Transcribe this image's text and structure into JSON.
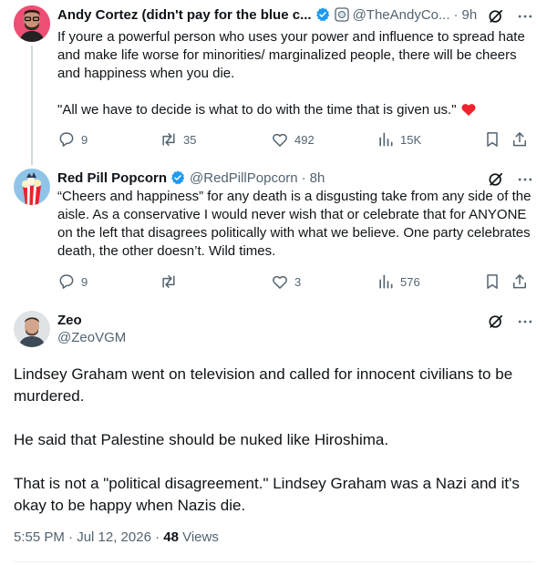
{
  "tweets": [
    {
      "name": "Andy Cortez (didn't pay for the blue c...",
      "handle": "@TheAndyCo...",
      "time": "9h",
      "text": [
        "If youre a powerful person who uses your power and influence to spread hate and make life worse for minorities/ marginalized people, there will be cheers and happiness when you die.",
        "\"All we have to decide is what to do with the time that is given us.\""
      ],
      "replies": "9",
      "reposts": "35",
      "likes": "492",
      "views": "15K"
    },
    {
      "name": "Red Pill Popcorn",
      "handle": "@RedPillPopcorn",
      "time": "8h",
      "text": [
        "“Cheers and happiness” for any death is a disgusting take from any side of the aisle. As a conservative I would never wish that or celebrate that for ANYONE on the left that disagrees politically with what we believe. One party celebrates death, the other doesn’t. Wild times."
      ],
      "replies": "9",
      "reposts": "",
      "likes": "3",
      "views": "576"
    }
  ],
  "focal": {
    "name": "Zeo",
    "handle": "@ZeoVGM",
    "paragraphs": [
      "Lindsey Graham went on television and called for innocent civilians to be murdered.",
      "He said that Palestine should be nuked like Hiroshima.",
      "That is not a \"political disagreement.\" Lindsey Graham was a Nazi and it's okay to be happy when Nazis die."
    ],
    "time": "5:55 PM · Jul 12, 2026 · ",
    "views_count": "48",
    "views_label": " Views"
  },
  "colors": {
    "verified": "#1d9bf0",
    "heart": "#f4212e",
    "muted": "#536471",
    "text": "#0f1419"
  },
  "icons": {
    "reply": "reply-icon",
    "repost": "repost-icon",
    "like": "heart-icon",
    "views": "views-icon",
    "bookmark": "bookmark-icon",
    "share": "share-icon",
    "grok": "grok-icon",
    "more": "more-icon"
  }
}
